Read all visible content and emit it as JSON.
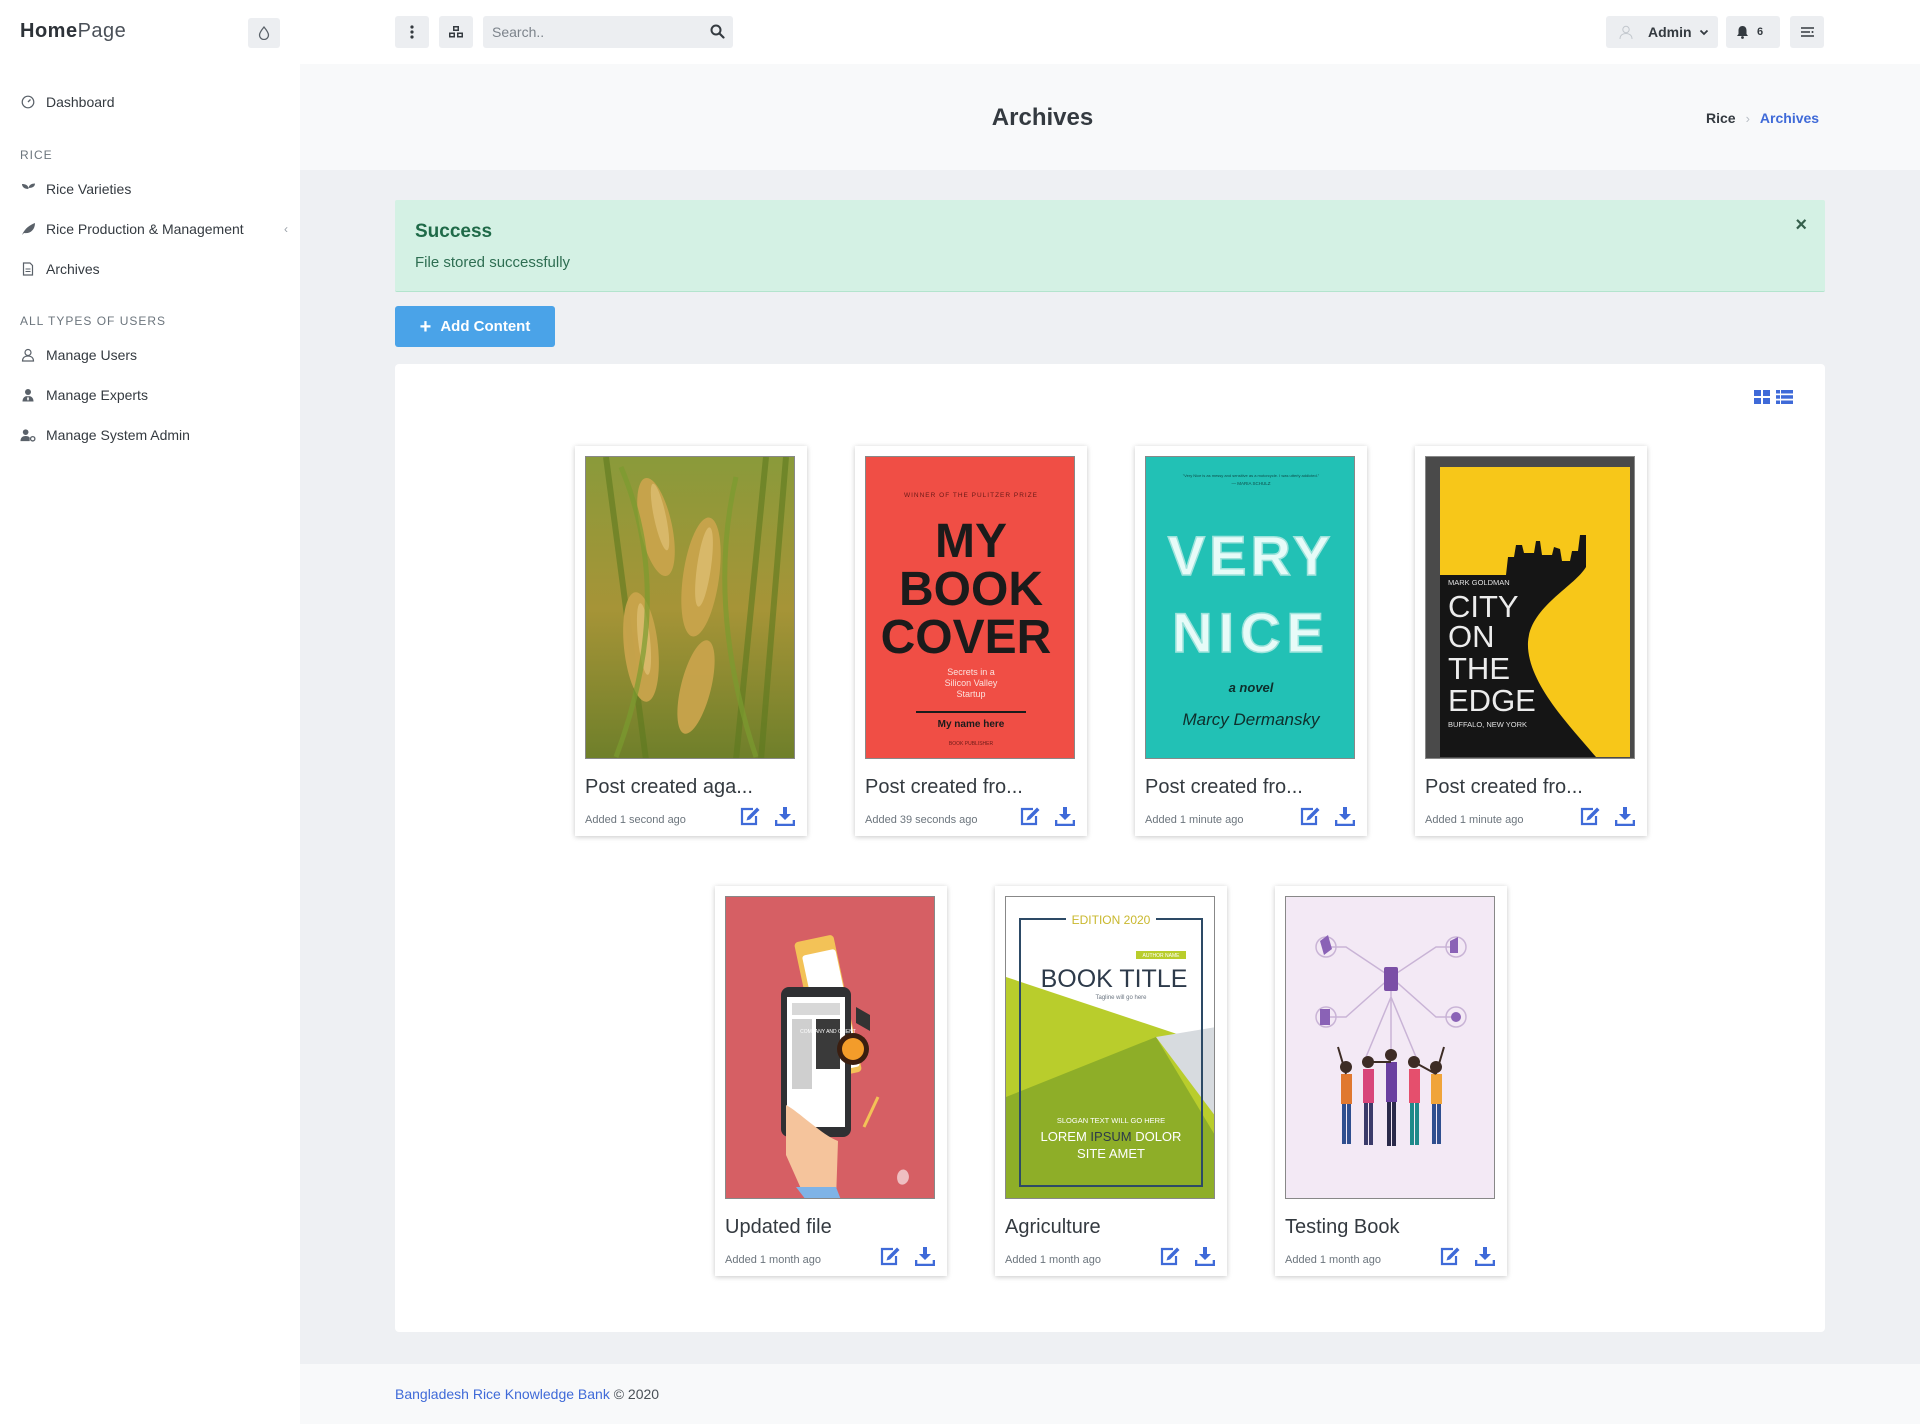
{
  "app": {
    "brand_primary": "Home",
    "brand_secondary": "Page"
  },
  "topbar": {
    "search_placeholder": "Search..",
    "admin_label": "Admin",
    "notifications_count": "6"
  },
  "sidebar": {
    "dashboard": "Dashboard",
    "section_rice": "RICE",
    "rice_varieties": "Rice Varieties",
    "rice_production": "Rice Production & Management",
    "archives": "Archives",
    "section_users": "ALL TYPES OF USERS",
    "manage_users": "Manage Users",
    "manage_experts": "Manage Experts",
    "manage_system_admin": "Manage System Admin"
  },
  "page": {
    "title": "Archives",
    "breadcrumb": [
      "Rice",
      "Archives"
    ]
  },
  "alert": {
    "title": "Success",
    "message": "File stored successfully",
    "close": "×"
  },
  "add_button": {
    "label": "Add Content"
  },
  "cards": [
    {
      "title": "Post created aga...",
      "added": "Added 1 second ago",
      "cover": "rice-field"
    },
    {
      "title": "Post created fro...",
      "added": "Added 39 seconds ago",
      "cover": "my-book-cover",
      "cover_text": {
        "top": "WINNER OF THE PULITZER PRIZE",
        "line1": "MY",
        "line2": "BOOK",
        "line3": "COVER",
        "sub1": "Secrets in a",
        "sub2": "Silicon Valley",
        "sub3": "Startup",
        "author": "My name here",
        "publisher": "BOOK PUBLISHER"
      }
    },
    {
      "title": "Post created fro...",
      "added": "Added 1 minute ago",
      "cover": "very-nice",
      "cover_text": {
        "quote": "\"Very Nice is as messy and sensitive as a motorcycle. I was utterly addicted.\"",
        "quote_by": "— MARIA SCHULZ",
        "line1": "VERY",
        "line2": "NICE",
        "tag": "a novel",
        "author": "Marcy Dermansky"
      }
    },
    {
      "title": "Post created fro...",
      "added": "Added 1 minute ago",
      "cover": "city-on-the-edge",
      "cover_text": {
        "author": "MARK GOLDMAN",
        "line1": "CITY",
        "line2": "ON",
        "line3": "THE",
        "line4": "EDGE",
        "place": "BUFFALO, NEW YORK"
      }
    },
    {
      "title": "Updated file",
      "added": "Added 1 month ago",
      "cover": "reading-illustration",
      "cover_text": {
        "book": "COMPANY AND CLIENT"
      }
    },
    {
      "title": "Agriculture",
      "added": "Added 1 month ago",
      "cover": "book-title",
      "cover_text": {
        "edition": "EDITION 2020",
        "author_tag": "AUTHOR NAME",
        "title": "BOOK TITLE",
        "tagline": "Tagline will go here",
        "slogan": "SLOGAN TEXT WILL GO HERE",
        "lorem_a": "LOREM",
        "lorem_b": "IPSUM",
        "lorem_c": "DOLOR",
        "site": "SITE AMET"
      }
    },
    {
      "title": "Testing Book",
      "added": "Added 1 month ago",
      "cover": "team-network"
    }
  ],
  "footer": {
    "link": "Bangladesh Rice Knowledge Bank",
    "suffix": " © 2020"
  },
  "colors": {
    "accent": "#3f6ad8",
    "success_bg": "#d4f1e4",
    "button_blue": "#4aa3e8",
    "icon_blue": "#3f6ad8"
  }
}
